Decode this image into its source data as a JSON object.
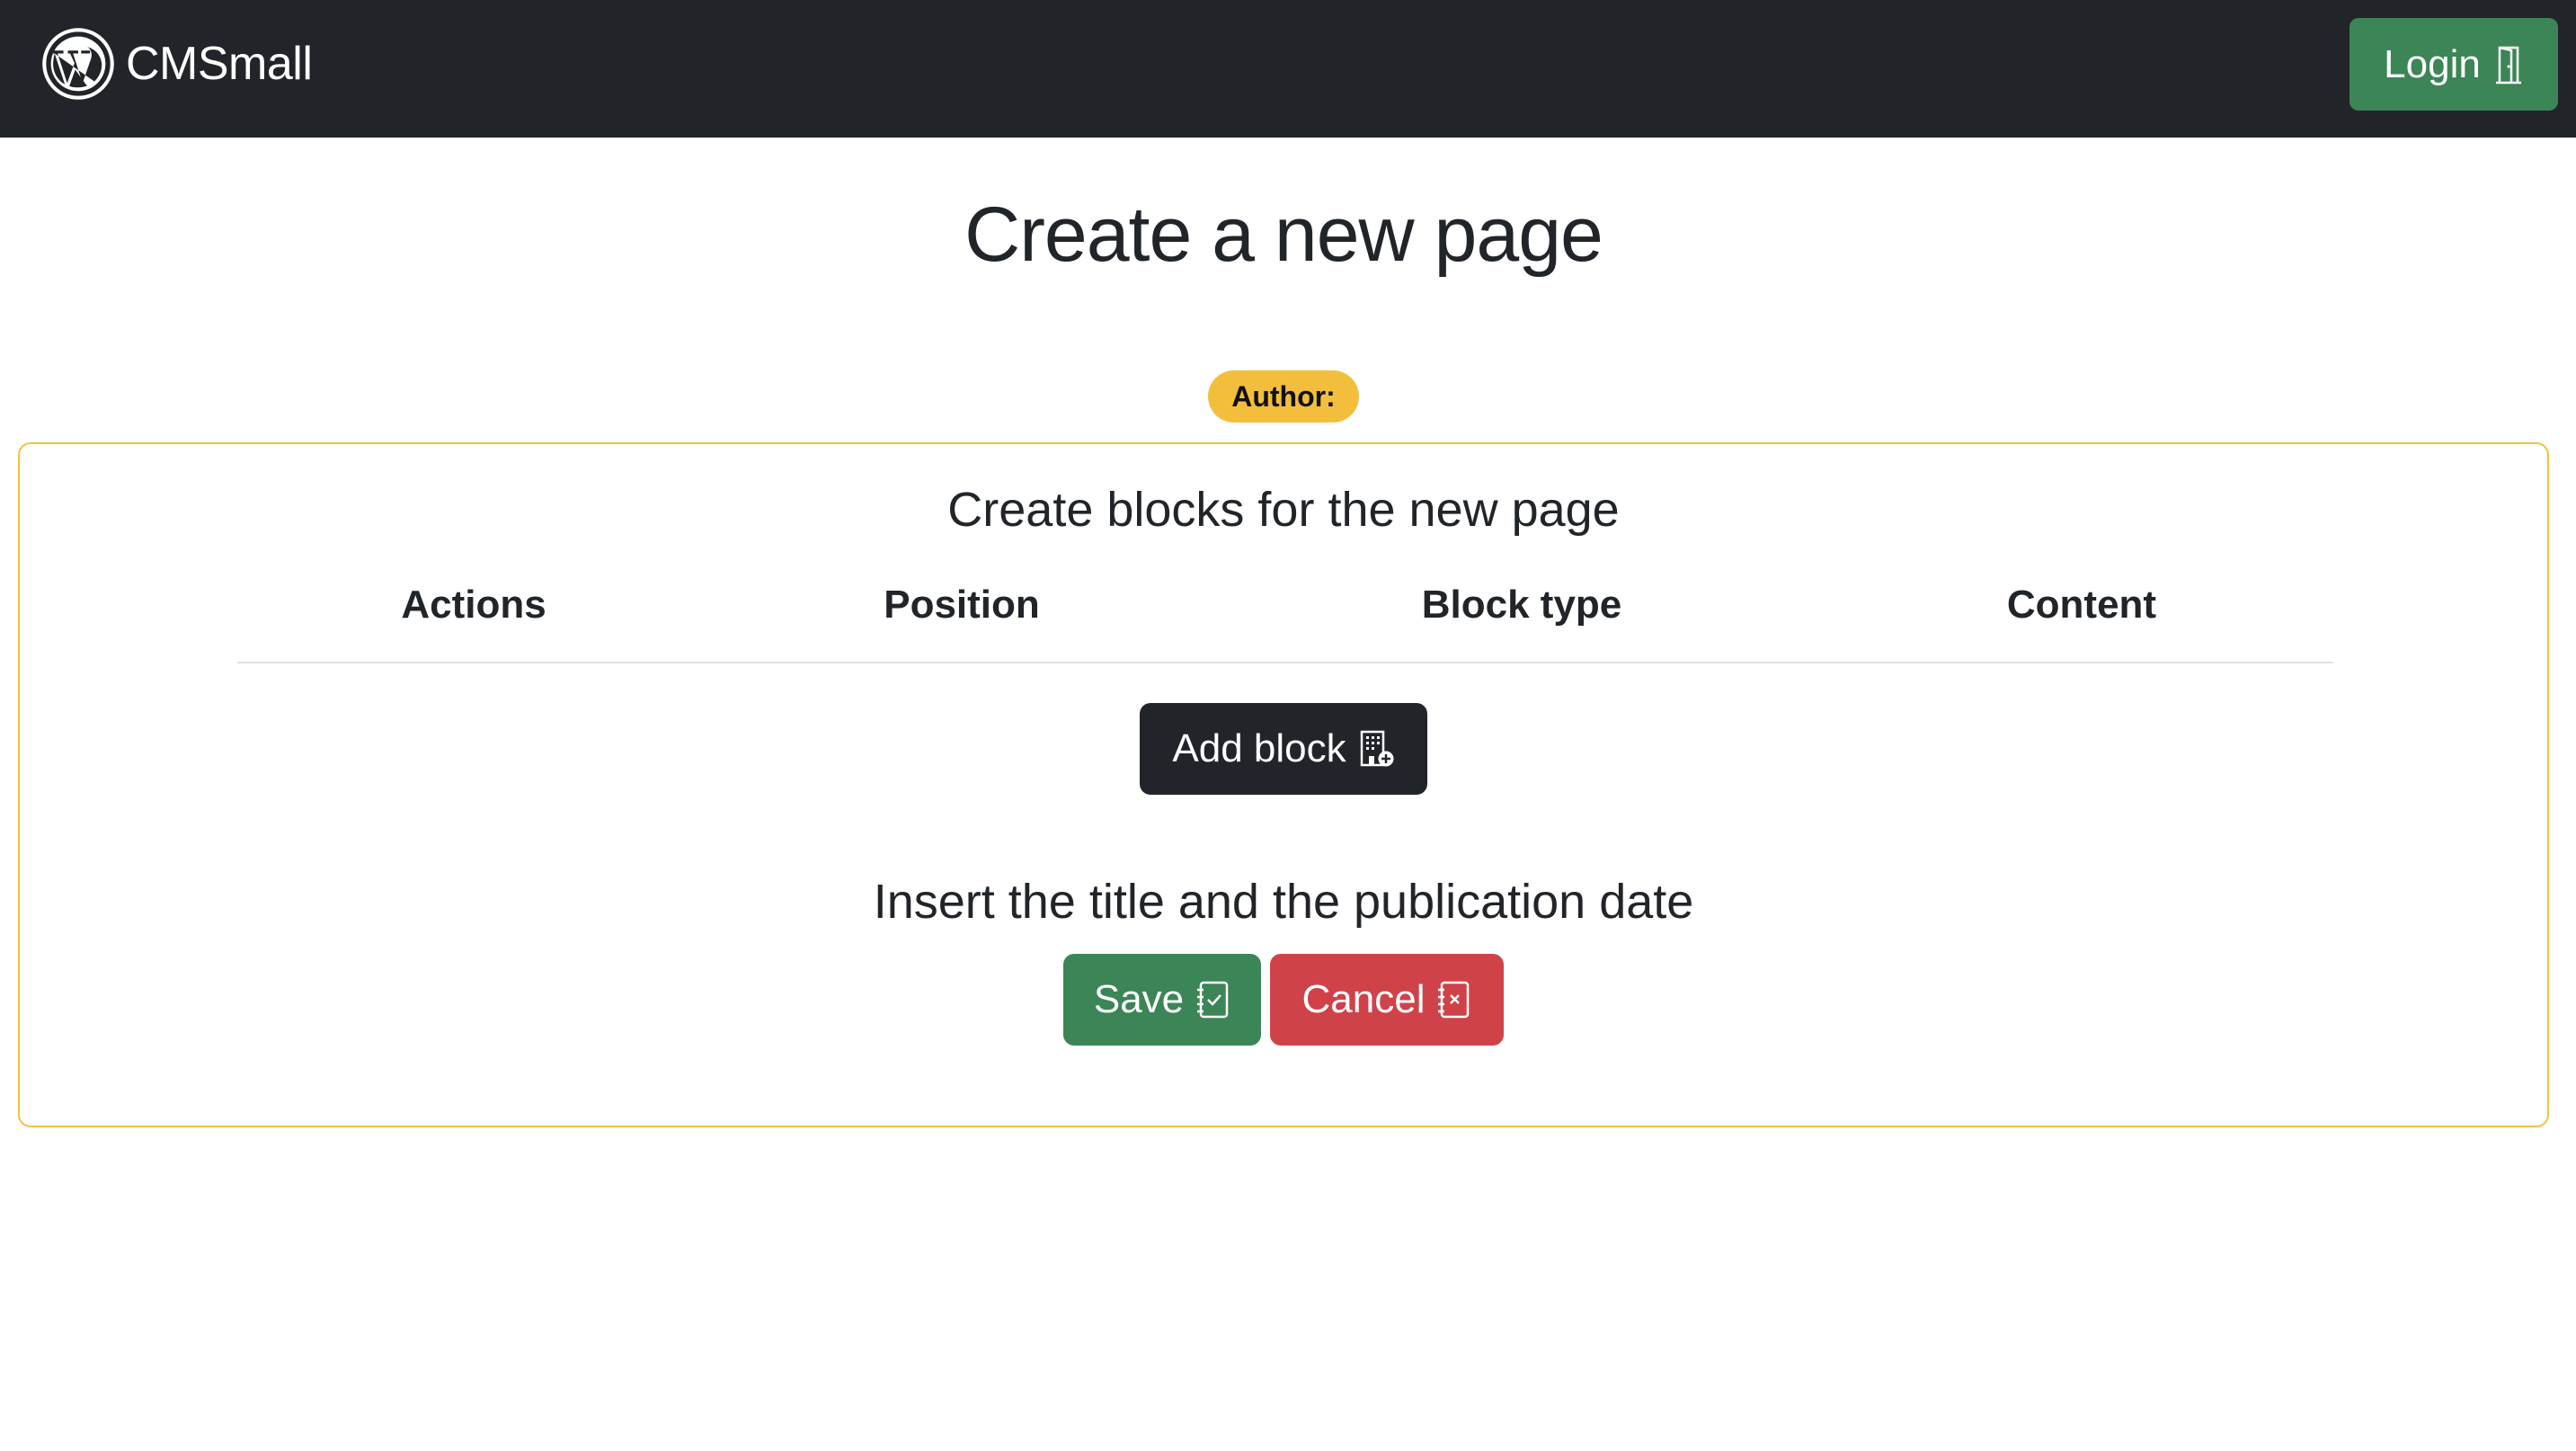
{
  "navbar": {
    "brand_name": "CMSmall",
    "logo_icon": "wordpress-logo-icon",
    "login_label": "Login",
    "login_icon": "door-icon",
    "background_color": "#212529",
    "login_color": "#3b8556"
  },
  "main": {
    "title": "Create a new page",
    "author_badge": "Author:",
    "author_badge_color": "#f3be3c"
  },
  "card": {
    "border_color": "#f0c43f",
    "heading": "Create blocks for the new page",
    "columns": [
      "Actions",
      "Position",
      "Block type",
      "Content"
    ],
    "add_block_label": "Add block",
    "add_block_icon": "building-add-icon",
    "sub_heading": "Insert the title and the publication date",
    "save_label": "Save",
    "save_icon": "journal-check-icon",
    "cancel_label": "Cancel",
    "cancel_icon": "journal-x-icon",
    "save_color": "#3b8556",
    "cancel_color": "#d04249"
  }
}
